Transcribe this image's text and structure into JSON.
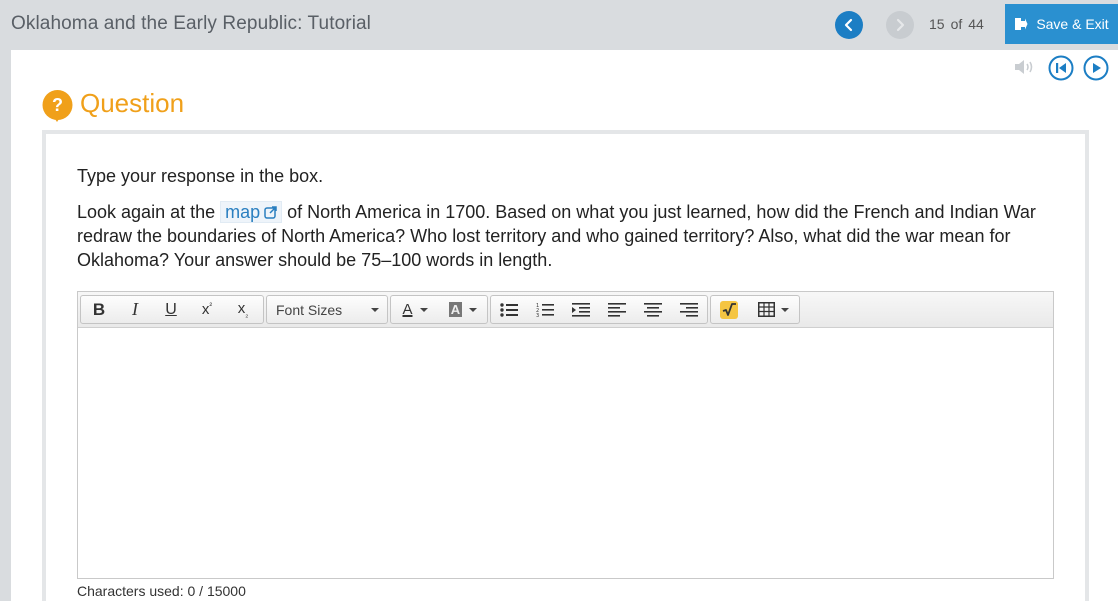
{
  "header": {
    "title": "Oklahoma and the Early Republic: Tutorial",
    "current_page": "15",
    "of_label": "of",
    "total_pages": "44",
    "save_exit_label": "Save & Exit"
  },
  "question": {
    "heading": "Question",
    "instruction": "Type your response in the box.",
    "prompt_before_link": "Look again at the ",
    "link_text": "map",
    "prompt_after_link": " of North America in 1700. Based on what you just learned, how did the French and Indian War redraw the boundaries of North America? Who lost territory and who gained territory? Also, what did the war mean for Oklahoma? Your answer should be 75–100 words in length."
  },
  "editor": {
    "font_sizes_label": "Font Sizes",
    "toolbar_buttons": [
      "bold",
      "italic",
      "underline",
      "superscript",
      "subscript",
      "font-sizes",
      "font-color",
      "background-color",
      "bulleted-list",
      "numbered-list",
      "indent",
      "align-left",
      "align-center",
      "align-right",
      "math-equation",
      "table"
    ],
    "content": ""
  },
  "footer": {
    "characters_used_label": "Characters used: 0 / 15000"
  },
  "colors": {
    "accent_blue": "#1c7ec4",
    "save_button": "#2a90d0",
    "question_orange": "#f0a01a",
    "topbar_gray": "#d9dcdf"
  }
}
